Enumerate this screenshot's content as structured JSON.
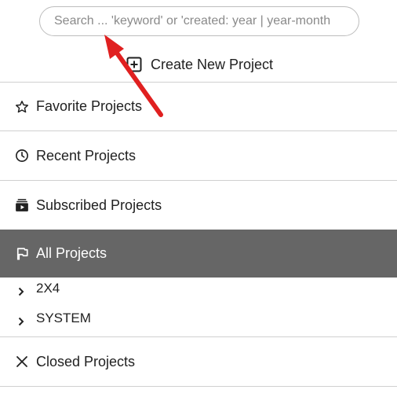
{
  "search": {
    "placeholder": "Search ... 'keyword' or 'created: year | year-month"
  },
  "create": {
    "label": "Create New Project",
    "icon": "plus-square-icon"
  },
  "sections": {
    "favorite": {
      "label": "Favorite Projects",
      "icon": "star-icon"
    },
    "recent": {
      "label": "Recent Projects",
      "icon": "clock-icon"
    },
    "subscribed": {
      "label": "Subscribed Projects",
      "icon": "subscriptions-icon"
    },
    "all": {
      "label": "All Projects",
      "icon": "flag-icon",
      "active": true
    },
    "closed": {
      "label": "Closed Projects",
      "icon": "close-icon"
    }
  },
  "all_projects_items": [
    {
      "label": "2X4",
      "icon": "chevron-right-icon"
    },
    {
      "label": "SYSTEM",
      "icon": "chevron-right-icon"
    }
  ],
  "colors": {
    "active_background": "#666666",
    "annotation_arrow": "#e02020"
  }
}
